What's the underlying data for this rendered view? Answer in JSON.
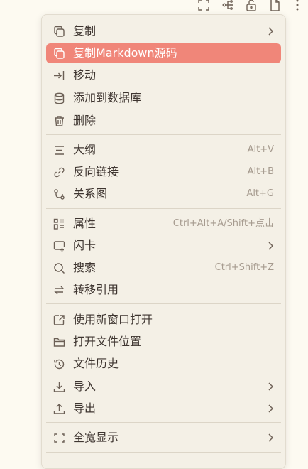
{
  "toolbar": {
    "icons": [
      "fullscreen-icon",
      "outline-tree-icon",
      "lock-icon",
      "document-icon",
      "more-vertical-icon"
    ]
  },
  "menu": {
    "groups": [
      [
        {
          "label": "复制",
          "icon": "copy-icon",
          "submenu": true
        },
        {
          "label": "复制Markdown源码",
          "icon": "copy-icon",
          "active": true
        },
        {
          "label": "移动",
          "icon": "move-icon"
        },
        {
          "label": "添加到数据库",
          "icon": "database-icon"
        },
        {
          "label": "删除",
          "icon": "trash-icon"
        }
      ],
      [
        {
          "label": "大纲",
          "icon": "outline-icon",
          "shortcut": "Alt+V"
        },
        {
          "label": "反向链接",
          "icon": "link-icon",
          "shortcut": "Alt+B"
        },
        {
          "label": "关系图",
          "icon": "graph-icon",
          "shortcut": "Alt+G"
        }
      ],
      [
        {
          "label": "属性",
          "icon": "attributes-icon",
          "shortcut": "Ctrl+Alt+A/Shift+点击"
        },
        {
          "label": "闪卡",
          "icon": "flashcard-icon",
          "submenu": true
        },
        {
          "label": "搜索",
          "icon": "search-icon",
          "shortcut": "Ctrl+Shift+Z"
        },
        {
          "label": "转移引用",
          "icon": "transfer-icon"
        }
      ],
      [
        {
          "label": "使用新窗口打开",
          "icon": "open-window-icon"
        },
        {
          "label": "打开文件位置",
          "icon": "folder-icon"
        },
        {
          "label": "文件历史",
          "icon": "history-icon"
        },
        {
          "label": "导入",
          "icon": "import-icon",
          "submenu": true
        },
        {
          "label": "导出",
          "icon": "export-icon",
          "submenu": true
        }
      ],
      [
        {
          "label": "全宽显示",
          "icon": "full-width-icon",
          "submenu": true
        }
      ]
    ]
  }
}
